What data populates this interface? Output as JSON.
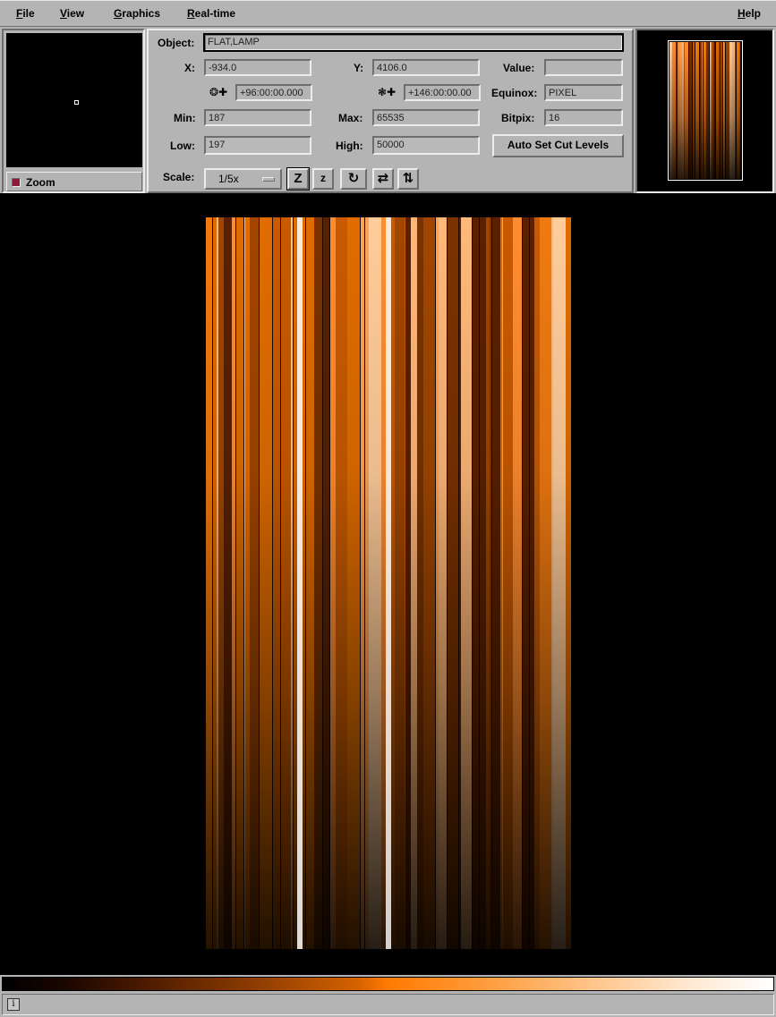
{
  "menu": {
    "file": "File",
    "view": "View",
    "graphics": "Graphics",
    "realtime": "Real-time",
    "help": "Help"
  },
  "zoom": {
    "label": "Zoom",
    "checked": true
  },
  "info": {
    "object_label": "Object:",
    "object_value": "FLAT,LAMP",
    "x_label": "X:",
    "x_value": "-934.0",
    "y_label": "Y:",
    "y_value": "4106.0",
    "value_label": "Value:",
    "value_value": "",
    "ra_value": "+96:00:00.000",
    "dec_value": "+146:00:00.00",
    "equinox_label": "Equinox:",
    "equinox_value": "PIXEL",
    "min_label": "Min:",
    "min_value": "187",
    "max_label": "Max:",
    "max_value": "65535",
    "bitpix_label": "Bitpix:",
    "bitpix_value": "16",
    "low_label": "Low:",
    "low_value": "197",
    "high_label": "High:",
    "high_value": "50000",
    "auto_cut_button": "Auto Set Cut Levels",
    "scale_label": "Scale:",
    "scale_value": "1/5x"
  },
  "toolbar_icons": [
    "zoom-in-icon",
    "zoom-out-icon",
    "rotate-icon",
    "flip-x-icon",
    "flip-y-icon"
  ],
  "colors": {
    "panel_bg": "#b4b4b4",
    "colormap_low": "#000000",
    "colormap_mid": "#ff7a00",
    "colormap_high": "#ffffff"
  },
  "status": {
    "icon": "i"
  }
}
